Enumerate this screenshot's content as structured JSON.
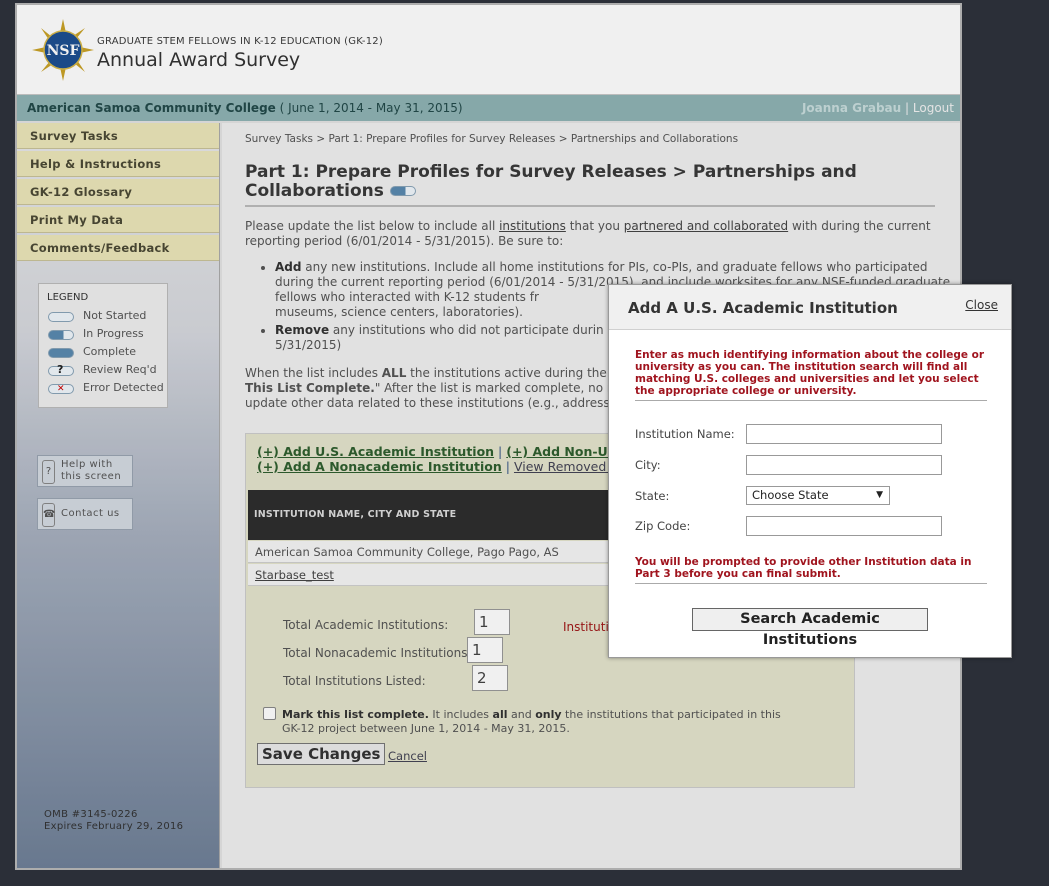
{
  "header": {
    "subtitle": "GRADUATE STEM FELLOWS IN K-12 EDUCATION (GK-12)",
    "title": "Annual Award Survey",
    "logo_text": "NSF"
  },
  "orgbar": {
    "org_name": "American Samoa Community College",
    "dates": " ( June 1, 2014 - May 31, 2015)",
    "user_name": "Joanna Grabau",
    "separator": "|",
    "logout": "Logout"
  },
  "sidebar": {
    "items": [
      {
        "label": "Survey Tasks"
      },
      {
        "label": "Help & Instructions"
      },
      {
        "label": "GK-12 Glossary"
      },
      {
        "label": "Print My Data"
      },
      {
        "label": "Comments/Feedback"
      }
    ],
    "legend": {
      "title": "LEGEND",
      "items": [
        "Not Started",
        "In Progress",
        "Complete",
        "Review Req'd",
        "Error Detected"
      ]
    },
    "help_button": {
      "line1": "Help with",
      "line2": "this screen",
      "icon": "?"
    },
    "contact_button": {
      "label": "Contact us"
    },
    "omb": {
      "line1": "OMB #3145-0226",
      "line2": "Expires February 29, 2016"
    }
  },
  "main": {
    "breadcrumb": "Survey Tasks > Part 1: Prepare Profiles for Survey Releases > Partnerships and Collaborations",
    "title": "Part 1: Prepare Profiles for Survey Releases > Partnerships and Collaborations",
    "intro_pre": "Please update the list below to include all ",
    "intro_link1": "institutions",
    "intro_mid": " that you ",
    "intro_link2": "partnered and collaborated",
    "intro_post": " with during the current reporting period (6/01/2014 - 5/31/2015). Be sure to:",
    "bullet1_bold": "Add",
    "bullet1_text": " any new institutions. Include all home institutions for PIs, co-PIs, and graduate fellows who participated during the current reporting period (6/01/2014 - 5/31/2015), and include worksites for any NSF-funded graduate fellows who interacted with K-12 students fr",
    "bullet1_text2": "museums, science centers, laboratories).",
    "bullet2_bold": "Remove",
    "bullet2_text": " any institutions who did not participate durin",
    "bullet2_text2": "5/31/2015)",
    "para2_pre": "When the list includes ",
    "para2_bold": "ALL",
    "para2_mid": " the institutions active during the ",
    "para2_bold2": "This List Complete.",
    "para2_mid2": "\" After the list is marked complete, no m",
    "para2_line3": "update other data related to these institutions (e.g., address)"
  },
  "panel": {
    "link_add_us": "(+) Add U.S. Academic Institution",
    "sep": " | ",
    "link_add_nonus": "(+) Add Non-U.S",
    "link_add_nonacad": "(+) Add A Nonacademic Institution",
    "link_view_removed": "View Removed In",
    "table_header": "INSTITUTION NAME, CITY AND STATE",
    "rows": [
      {
        "text": "American Samoa Community College, Pago Pago, AS"
      },
      {
        "text": "Starbase_test"
      }
    ],
    "totals": {
      "academic_label": "Total Academic Institutions:",
      "academic_value": "1",
      "nonacademic_label": "Total Nonacademic Institutions:",
      "nonacademic_value": "1",
      "listed_label": "Total Institutions Listed:",
      "listed_value": "2",
      "red_label": "Instituti"
    },
    "complete_bold": "Mark this list complete.",
    "complete_text1": " It includes ",
    "complete_all": "all",
    "complete_and": " and ",
    "complete_only": "only",
    "complete_text2": " the institutions that participated in this GK-12 project between June 1, 2014 - May 31, 2015.",
    "save_label": "Save Changes",
    "cancel_label": "Cancel"
  },
  "modal": {
    "title": "Add A U.S. Academic Institution",
    "close": "Close",
    "intro": "Enter as much identifying information about the college or university as you can. The institution search will find all matching U.S. colleges and universities and let you select the appropriate college or university.",
    "fields": {
      "name_label": "Institution Name:",
      "name_value": "",
      "city_label": "City:",
      "city_value": "",
      "state_label": "State:",
      "state_value": "Choose State",
      "zip_label": "Zip Code:",
      "zip_value": ""
    },
    "note": "You will be prompted to provide other Institution data in Part 3 before you can final submit.",
    "search_button": "Search Academic Institutions"
  },
  "colors": {
    "orgbar": "#8fb3b4",
    "nav_item": "#ebe6b9",
    "panel": "#e4e4cc",
    "modal_red": "#a0141e",
    "page_bg": "#2b2f38"
  }
}
